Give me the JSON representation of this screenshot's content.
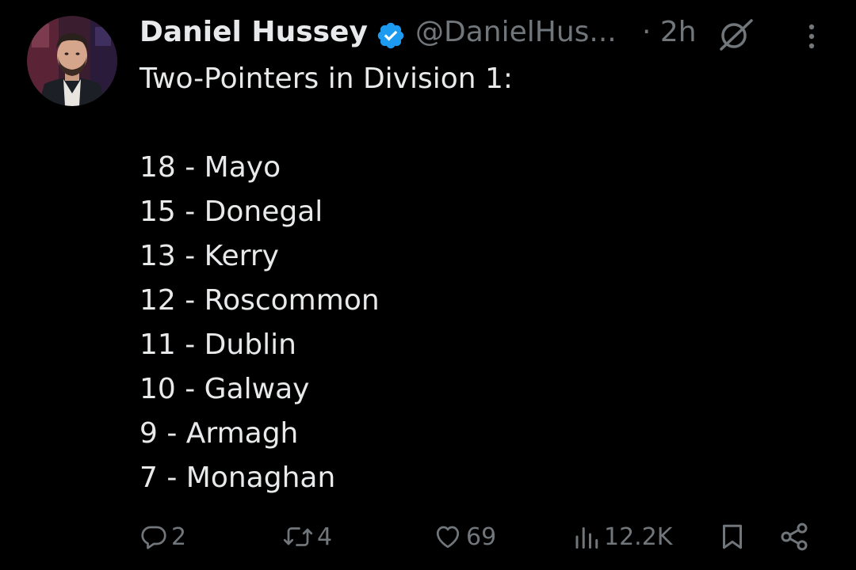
{
  "post": {
    "author": {
      "display_name": "Daniel Hussey",
      "handle": "@DanielHus...",
      "verified": true,
      "avatar_icon": "profile-photo"
    },
    "time_text": "· 2h",
    "lines": [
      "Two-Pointers in Division 1:",
      "",
      "18 - Mayo",
      "15 - Donegal",
      "13 - Kerry",
      "12 - Roscommon",
      "11 - Dublin",
      "10 - Galway",
      "9 - Armagh",
      "7 - Monaghan"
    ],
    "stats": {
      "replies": "2",
      "reposts": "4",
      "likes": "69",
      "views": "12.2K"
    }
  },
  "icons": {
    "verified": "verified-badge-icon",
    "grok": "grok-icon",
    "more": "more-vertical-icon",
    "reply": "reply-icon",
    "repost": "repost-icon",
    "like": "heart-icon",
    "views": "views-chart-icon",
    "bookmark": "bookmark-icon",
    "share": "share-icon"
  },
  "colors": {
    "background": "#000000",
    "text_primary": "#e7e9ea",
    "text_secondary": "#71767b",
    "verified_blue": "#1d9bf0"
  }
}
